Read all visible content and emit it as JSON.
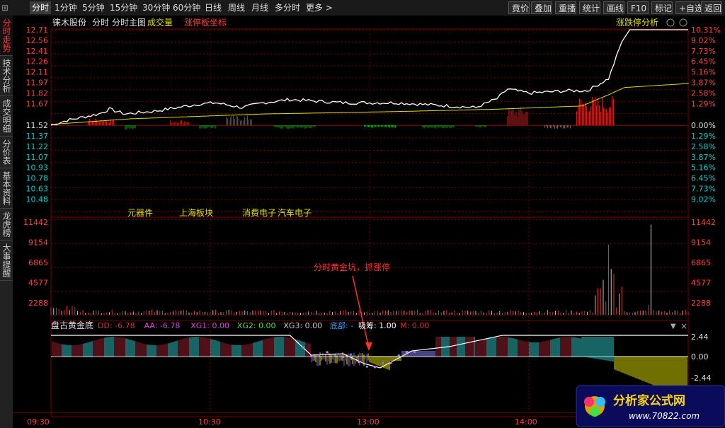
{
  "topbar": {
    "tabs": [
      "分时",
      "1分钟",
      "5分钟",
      "15分钟",
      "30分钟",
      "60分钟",
      "日线",
      "周线",
      "月线",
      "多分时",
      "更多 >"
    ],
    "right": [
      "竟价",
      "叠加",
      "重播",
      "统计",
      "画线",
      "F10",
      "标记",
      "+自选",
      "返回"
    ]
  },
  "lefttabs": [
    "分时走势",
    "技术分析",
    "成交明细",
    "分价表",
    "基本资料",
    "龙虎榜",
    "大事提醒"
  ],
  "header": {
    "stock": "徕木股份",
    "mode": "分时",
    "main": "分时主图",
    "vol": "成交量",
    "limit": "涨停板坐标",
    "right": "涨跌停分析"
  },
  "price_axis": {
    "left_up": [
      "12.71",
      "12.56",
      "12.41",
      "12.26",
      "12.11",
      "11.97",
      "11.82",
      "11.67"
    ],
    "center": "11.52",
    "left_down": [
      "11.37",
      "11.22",
      "11.07",
      "10.93",
      "10.78",
      "10.63",
      "10.48"
    ],
    "right_up": [
      "10.31%",
      "9.02%",
      "7.73%",
      "6.45%",
      "5.16%",
      "3.87%",
      "2.58%",
      "1.29%"
    ],
    "center_pct": "0.00%",
    "right_down": [
      "1.29%",
      "2.58%",
      "3.87%",
      "5.16%",
      "6.45%",
      "7.73%",
      "9.02%"
    ]
  },
  "tags": [
    "元器件",
    "上海板块",
    "消费电子",
    "汽车电子"
  ],
  "vol_axis": [
    "11442",
    "9154",
    "6865",
    "4577",
    "2288"
  ],
  "indicator": {
    "name": "盘古黄金底",
    "params": [
      {
        "label": "DD: -6.78",
        "color": "#e03030"
      },
      {
        "label": "AA: -6.78",
        "color": "#e040e0"
      },
      {
        "label": "XG1: 0.00",
        "color": "#e040e0"
      },
      {
        "label": "XG2: 0.00",
        "color": "#40e040"
      },
      {
        "label": "XG3: 0.00",
        "color": "#cccccc"
      },
      {
        "label": "底部: -",
        "color": "#40a0ff"
      },
      {
        "label": "吸筹: 1.00",
        "color": "#ffffff"
      },
      {
        "label": "M: 0.00",
        "color": "#e03030"
      }
    ],
    "axis": [
      "2.44",
      "0.00",
      "-2.44"
    ]
  },
  "annotation": "分时黄金坑，抓涨停",
  "time_axis": [
    "09:30",
    "10:30",
    "13:00",
    "14:00"
  ],
  "watermark": {
    "title": "分析家公式网",
    "url": "www.70822.com"
  },
  "colors": {
    "price": "#ffffff",
    "avg": "#e0e000",
    "up": "#e03030",
    "down": "#00c0c0",
    "green": "#00c000",
    "grid": "#8b0000"
  }
}
